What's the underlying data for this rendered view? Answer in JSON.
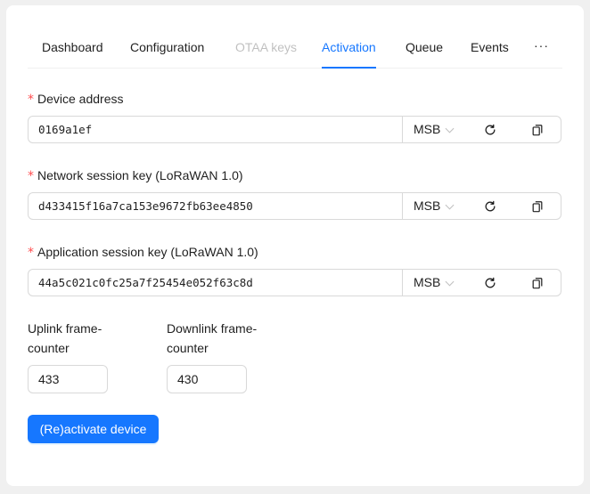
{
  "tabs": [
    {
      "label": "Dashboard",
      "state": "normal"
    },
    {
      "label": "Configuration",
      "state": "normal"
    },
    {
      "label": "OTAA keys",
      "state": "disabled"
    },
    {
      "label": "Activation",
      "state": "active"
    },
    {
      "label": "Queue",
      "state": "normal"
    },
    {
      "label": "Events",
      "state": "normal"
    }
  ],
  "tabs_more": "···",
  "required_mark": "*",
  "fields": {
    "device_address": {
      "label": "Device address",
      "value": "0169a1ef",
      "byte_order": "MSB"
    },
    "nwk_s_key": {
      "label": "Network session key (LoRaWAN 1.0)",
      "value": "d433415f16a7ca153e9672fb63ee4850",
      "byte_order": "MSB"
    },
    "app_s_key": {
      "label": "Application session key (LoRaWAN 1.0)",
      "value": "44a5c021c0fc25a7f25454e052f63c8d",
      "byte_order": "MSB"
    }
  },
  "counters": {
    "uplink": {
      "label": "Uplink frame-counter",
      "value": "433"
    },
    "downlink": {
      "label": "Downlink frame-counter",
      "value": "430"
    }
  },
  "submit_label": "(Re)activate device",
  "colors": {
    "primary": "#1677ff",
    "required": "#ff4d4f",
    "border": "#d9d9d9"
  },
  "icons": {
    "refresh": "reload-icon",
    "copy": "copy-icon",
    "select_arrow": "chevron-down-icon"
  }
}
